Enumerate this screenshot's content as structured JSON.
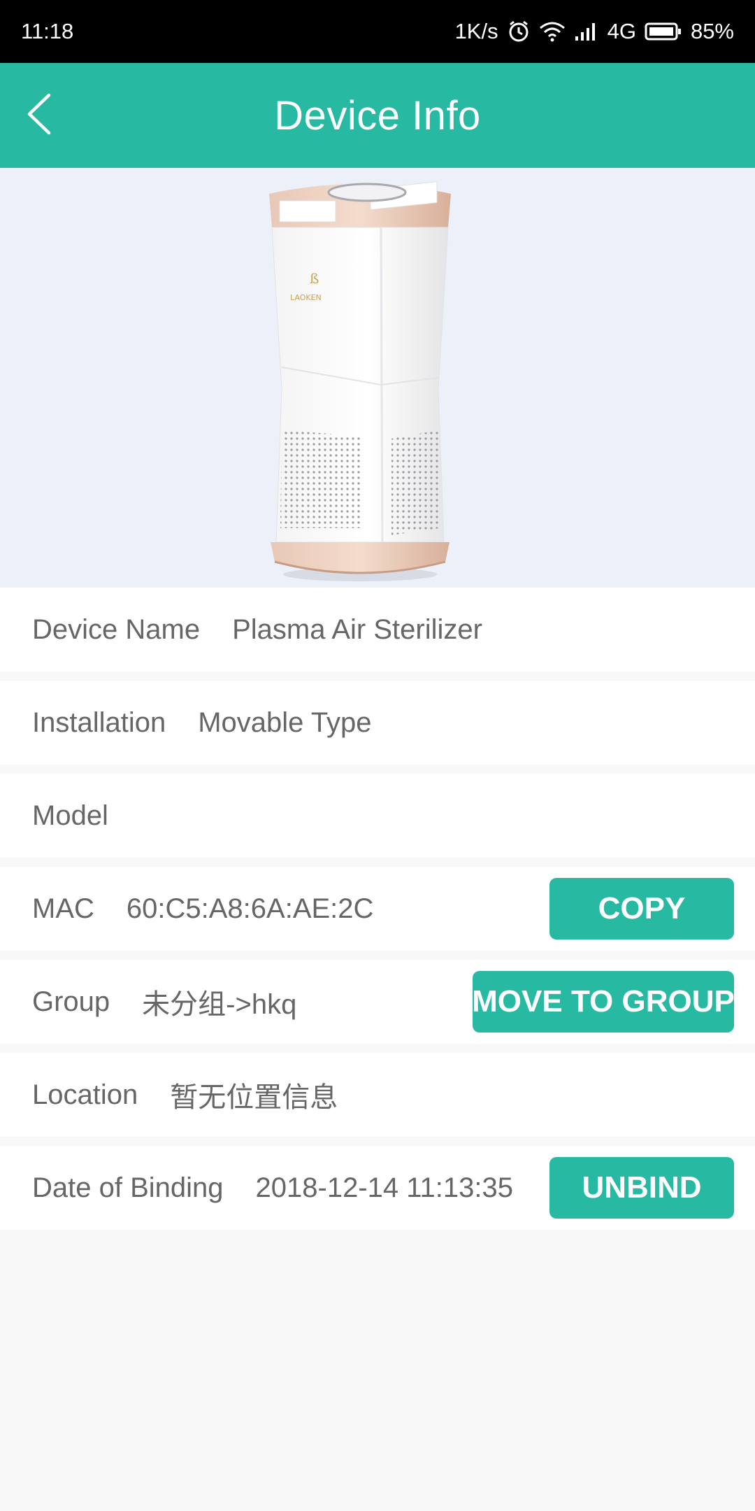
{
  "status_bar": {
    "time": "11:18",
    "net_speed": "1K/s",
    "network_type": "4G",
    "battery": "85%",
    "icons": [
      "alarm-icon",
      "wifi-icon",
      "signal-icon",
      "battery-icon"
    ]
  },
  "header": {
    "title": "Device Info",
    "back_icon": "chevron-left-icon"
  },
  "hero": {
    "brand_text": "LAOKEN"
  },
  "rows": {
    "device_name": {
      "label": "Device Name",
      "value": "Plasma Air Sterilizer"
    },
    "installation": {
      "label": "Installation",
      "value": "Movable Type"
    },
    "model": {
      "label": "Model",
      "value": ""
    },
    "mac": {
      "label": "MAC",
      "value": "60:C5:A8:6A:AE:2C",
      "button": "COPY"
    },
    "group": {
      "label": "Group",
      "value": "未分组->hkq",
      "button": "MOVE TO GROUP"
    },
    "location": {
      "label": "Location",
      "value": "暂无位置信息"
    },
    "binding": {
      "label": "Date of Binding",
      "value": "2018-12-14 11:13:35",
      "button": "UNBIND"
    }
  },
  "colors": {
    "accent": "#27b9a2",
    "status_bar": "#000000",
    "hero_bg": "#ecf1f9",
    "page_bg": "#f8f8f8",
    "text": "#666666"
  }
}
